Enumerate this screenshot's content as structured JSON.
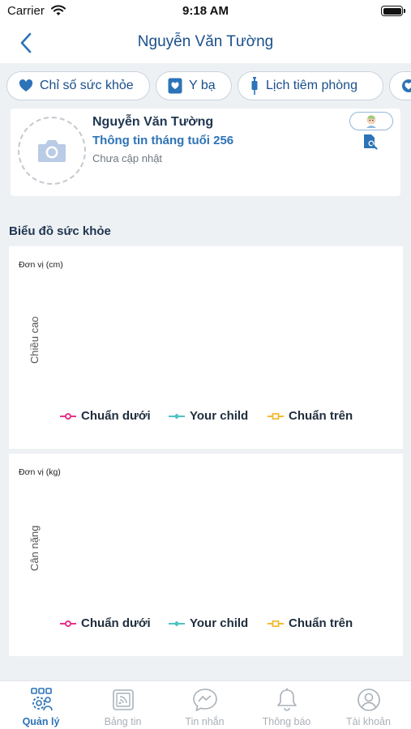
{
  "status_bar": {
    "carrier": "Carrier",
    "time": "9:18 AM"
  },
  "nav": {
    "title": "Nguyễn Văn Tường"
  },
  "tabs": [
    {
      "label": "Chỉ số sức khỏe",
      "icon": "heart-icon"
    },
    {
      "label": "Y bạ",
      "icon": "medical-book-icon"
    },
    {
      "label": "Lịch tiêm phòng",
      "icon": "syringe-icon"
    },
    {
      "label": "",
      "icon": "heart-icon"
    }
  ],
  "profile": {
    "name": "Nguyễn Văn Tường",
    "age_info": "Thông tin tháng tuổi 256",
    "update_status": "Chưa cập nhật"
  },
  "section_title": "Biểu đồ sức khỏe",
  "charts": [
    {
      "unit": "Đơn vị (cm)",
      "y_label": "Chiều cao",
      "legend": [
        {
          "label": "Chuẩn dưới",
          "color": "#e8338a"
        },
        {
          "label": "Your child",
          "color": "#4fc2c2"
        },
        {
          "label": "Chuẩn trên",
          "color": "#f5b82e"
        }
      ]
    },
    {
      "unit": "Đơn vị (kg)",
      "y_label": "Cân nặng",
      "legend": [
        {
          "label": "Chuẩn dưới",
          "color": "#e8338a"
        },
        {
          "label": "Your child",
          "color": "#4fc2c2"
        },
        {
          "label": "Chuẩn trên",
          "color": "#f5b82e"
        }
      ]
    }
  ],
  "tabbar": [
    {
      "label": "Quản lý",
      "icon": "management-icon",
      "active": true
    },
    {
      "label": "Bảng tin",
      "icon": "news-icon",
      "active": false
    },
    {
      "label": "Tin nhắn",
      "icon": "message-icon",
      "active": false
    },
    {
      "label": "Thông báo",
      "icon": "bell-icon",
      "active": false
    },
    {
      "label": "Tài khoản",
      "icon": "account-icon",
      "active": false
    }
  ],
  "colors": {
    "accent": "#2d73b7",
    "title": "#1a4f8b",
    "inactive": "#a9b0b8"
  }
}
